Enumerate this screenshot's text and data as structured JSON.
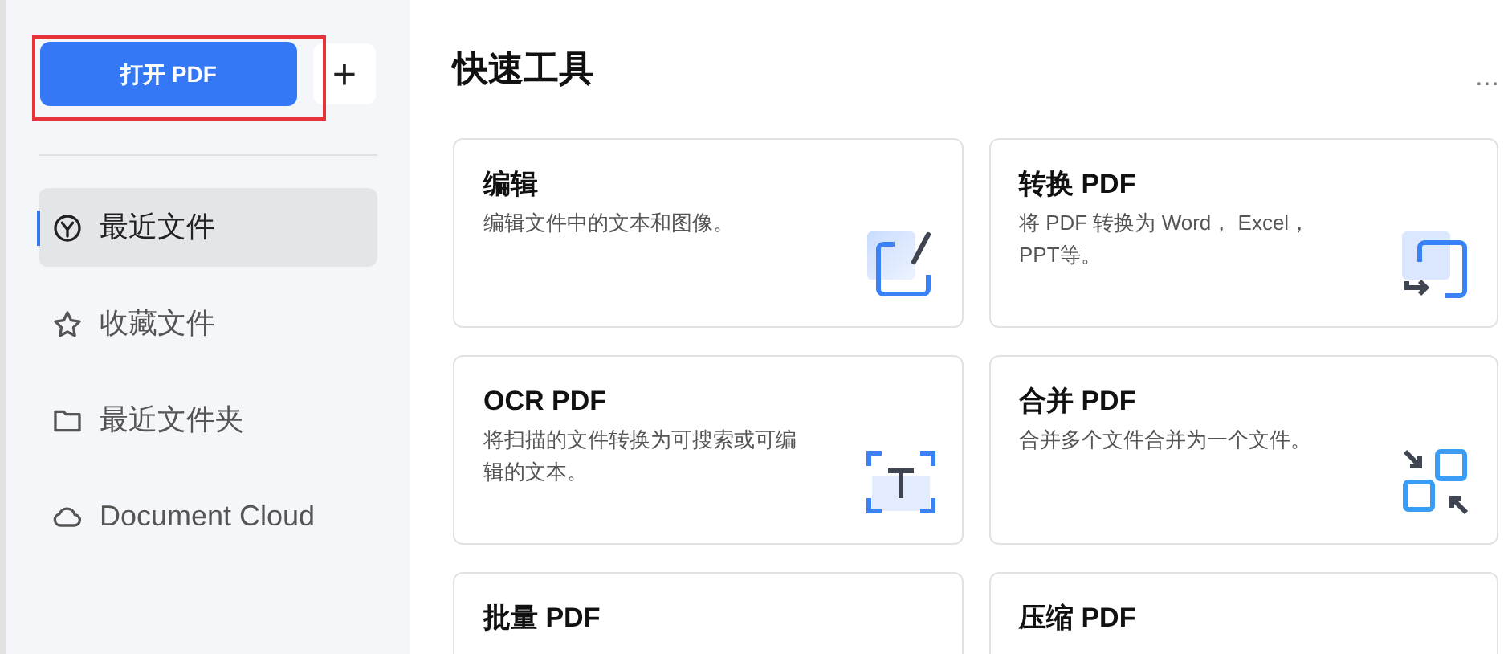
{
  "sidebar": {
    "open_button": "打开 PDF",
    "add_button": "+",
    "highlighted": true,
    "items": [
      {
        "label": "最近文件",
        "kind": "clock",
        "selected": true
      },
      {
        "label": "收藏文件",
        "kind": "star",
        "selected": false
      },
      {
        "label": "最近文件夹",
        "kind": "folder",
        "selected": false
      },
      {
        "label": "Document Cloud",
        "kind": "cloud",
        "selected": false
      }
    ]
  },
  "main": {
    "title": "快速工具",
    "more": "…",
    "tools": [
      {
        "title": "编辑",
        "description": "编辑文件中的文本和图像。",
        "kind": "edit"
      },
      {
        "title": "转换 PDF",
        "description": "将 PDF 转换为 Word， Excel，PPT等。",
        "kind": "convert"
      },
      {
        "title": "OCR PDF",
        "description": "将扫描的文件转换为可搜索或可编辑的文本。",
        "kind": "ocr"
      },
      {
        "title": "合并 PDF",
        "description": "合并多个文件合并为一个文件。",
        "kind": "merge"
      },
      {
        "title": "批量 PDF",
        "kind": "plain"
      },
      {
        "title": "压缩 PDF",
        "kind": "plain"
      }
    ]
  }
}
